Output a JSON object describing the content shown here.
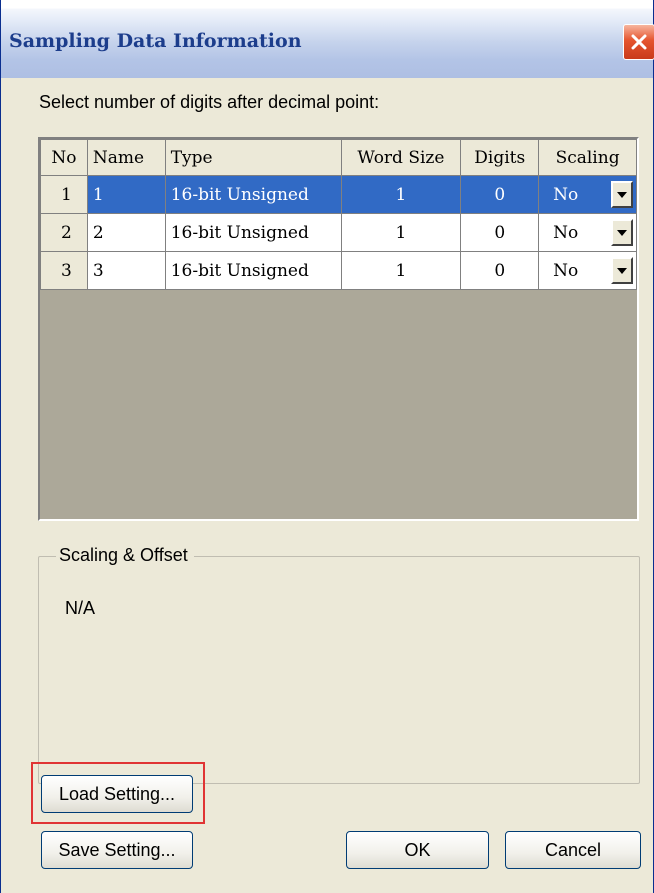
{
  "window": {
    "title": "Sampling Data Information"
  },
  "instruction": "Select number of digits after decimal point:",
  "table": {
    "columns": [
      "No",
      "Name",
      "Type",
      "Word Size",
      "Digits",
      "Scaling"
    ],
    "rows": [
      {
        "no": "1",
        "name": "1",
        "type": "16-bit Unsigned",
        "word_size": "1",
        "digits": "0",
        "scaling": "No",
        "selected": true
      },
      {
        "no": "2",
        "name": "2",
        "type": "16-bit Unsigned",
        "word_size": "1",
        "digits": "0",
        "scaling": "No",
        "selected": false
      },
      {
        "no": "3",
        "name": "3",
        "type": "16-bit Unsigned",
        "word_size": "1",
        "digits": "0",
        "scaling": "No",
        "selected": false
      }
    ]
  },
  "scaling_offset": {
    "title": "Scaling & Offset",
    "text": "N/A"
  },
  "buttons": {
    "load_setting": "Load Setting...",
    "save_setting": "Save Setting...",
    "ok": "OK",
    "cancel": "Cancel"
  },
  "colors": {
    "selection": "#316ac5",
    "highlight_border": "#e03434",
    "dialog_bg": "#ece9d8"
  },
  "icons": {
    "close": "close-icon",
    "dropdown": "chevron-down-icon"
  }
}
